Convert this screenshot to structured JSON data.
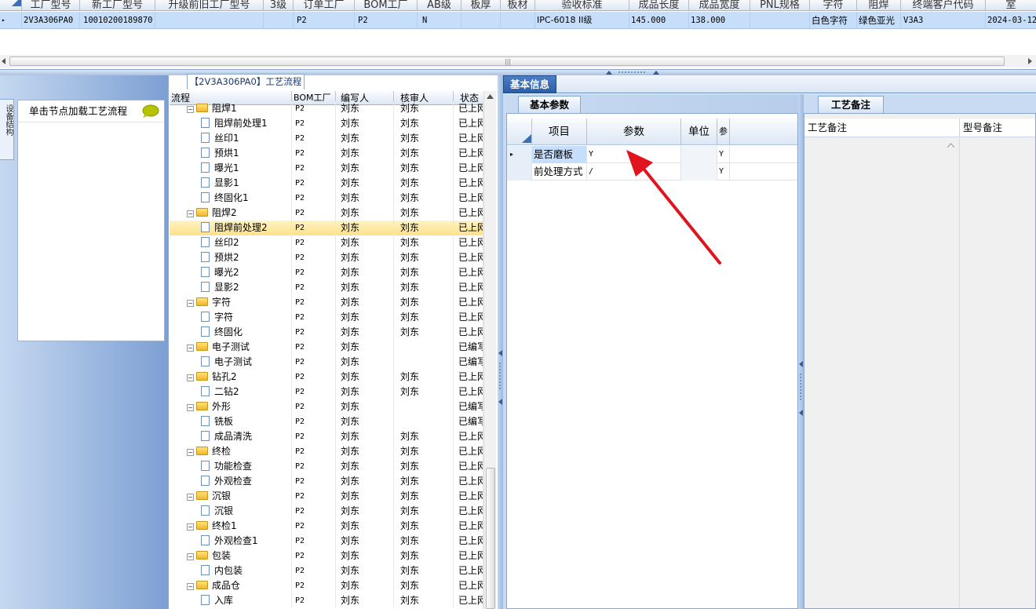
{
  "top_grid": {
    "headers": [
      "工厂型号",
      "新工厂型号",
      "升级前旧工厂型号",
      "3级",
      "订单工厂",
      "BOM工厂",
      "AB级",
      "板厚",
      "板材",
      "验收标准",
      "成品长度",
      "成品宽度",
      "PNL规格",
      "字符",
      "阻焊",
      "终端客户代码",
      "室"
    ],
    "row": {
      "marker": "▸",
      "cells": [
        "2V3A306PA0",
        "10010200189870",
        "",
        "",
        "P2",
        "P2",
        "N",
        "",
        "",
        "IPC-6018 II级",
        "145.000",
        "138.000",
        "",
        "白色字符",
        "绿色亚光",
        "V3A3",
        "2024-03-12"
      ]
    }
  },
  "left_panel": {
    "vertical_tab": "设备结构",
    "node_hint": "单击节点加载工艺流程"
  },
  "tree": {
    "title": "【2V3A306PA0】工艺流程",
    "columns": [
      "流程",
      "BOM工厂",
      "编写人",
      "核审人",
      "状态"
    ],
    "rows": [
      {
        "indent": 1,
        "type": "folder",
        "name": "阻焊1",
        "bom": "P2",
        "writer": "刘东",
        "reviewer": "刘东",
        "status": "已上网"
      },
      {
        "indent": 2,
        "type": "doc",
        "name": "阻焊前处理1",
        "bom": "P2",
        "writer": "刘东",
        "reviewer": "刘东",
        "status": "已上网"
      },
      {
        "indent": 2,
        "type": "doc",
        "name": "丝印1",
        "bom": "P2",
        "writer": "刘东",
        "reviewer": "刘东",
        "status": "已上网"
      },
      {
        "indent": 2,
        "type": "doc",
        "name": "预烘1",
        "bom": "P2",
        "writer": "刘东",
        "reviewer": "刘东",
        "status": "已上网"
      },
      {
        "indent": 2,
        "type": "doc",
        "name": "曝光1",
        "bom": "P2",
        "writer": "刘东",
        "reviewer": "刘东",
        "status": "已上网"
      },
      {
        "indent": 2,
        "type": "doc",
        "name": "显影1",
        "bom": "P2",
        "writer": "刘东",
        "reviewer": "刘东",
        "status": "已上网"
      },
      {
        "indent": 2,
        "type": "doc",
        "name": "终固化1",
        "bom": "P2",
        "writer": "刘东",
        "reviewer": "刘东",
        "status": "已上网"
      },
      {
        "indent": 1,
        "type": "folder",
        "name": "阻焊2",
        "bom": "P2",
        "writer": "刘东",
        "reviewer": "刘东",
        "status": "已上网"
      },
      {
        "indent": 2,
        "type": "doc",
        "name": "阻焊前处理2",
        "bom": "P2",
        "writer": "刘东",
        "reviewer": "刘东",
        "status": "已上网",
        "selected": true
      },
      {
        "indent": 2,
        "type": "doc",
        "name": "丝印2",
        "bom": "P2",
        "writer": "刘东",
        "reviewer": "刘东",
        "status": "已上网"
      },
      {
        "indent": 2,
        "type": "doc",
        "name": "预烘2",
        "bom": "P2",
        "writer": "刘东",
        "reviewer": "刘东",
        "status": "已上网"
      },
      {
        "indent": 2,
        "type": "doc",
        "name": "曝光2",
        "bom": "P2",
        "writer": "刘东",
        "reviewer": "刘东",
        "status": "已上网"
      },
      {
        "indent": 2,
        "type": "doc",
        "name": "显影2",
        "bom": "P2",
        "writer": "刘东",
        "reviewer": "刘东",
        "status": "已上网"
      },
      {
        "indent": 1,
        "type": "folder",
        "name": "字符",
        "bom": "P2",
        "writer": "刘东",
        "reviewer": "刘东",
        "status": "已上网"
      },
      {
        "indent": 2,
        "type": "doc",
        "name": "字符",
        "bom": "P2",
        "writer": "刘东",
        "reviewer": "刘东",
        "status": "已上网"
      },
      {
        "indent": 2,
        "type": "doc",
        "name": "终固化",
        "bom": "P2",
        "writer": "刘东",
        "reviewer": "刘东",
        "status": "已上网"
      },
      {
        "indent": 1,
        "type": "folder",
        "name": "电子测试",
        "bom": "P2",
        "writer": "刘东",
        "reviewer": "",
        "status": "已编写"
      },
      {
        "indent": 2,
        "type": "doc",
        "name": "电子测试",
        "bom": "P2",
        "writer": "刘东",
        "reviewer": "",
        "status": "已编写"
      },
      {
        "indent": 1,
        "type": "folder",
        "name": "钻孔2",
        "bom": "P2",
        "writer": "刘东",
        "reviewer": "刘东",
        "status": "已上网"
      },
      {
        "indent": 2,
        "type": "doc",
        "name": "二钻2",
        "bom": "P2",
        "writer": "刘东",
        "reviewer": "刘东",
        "status": "已上网"
      },
      {
        "indent": 1,
        "type": "folder",
        "name": "外形",
        "bom": "P2",
        "writer": "刘东",
        "reviewer": "",
        "status": "已编写"
      },
      {
        "indent": 2,
        "type": "doc",
        "name": "铣板",
        "bom": "P2",
        "writer": "刘东",
        "reviewer": "",
        "status": "已编写"
      },
      {
        "indent": 2,
        "type": "doc",
        "name": "成品清洗",
        "bom": "P2",
        "writer": "刘东",
        "reviewer": "刘东",
        "status": "已上网"
      },
      {
        "indent": 1,
        "type": "folder",
        "name": "终检",
        "bom": "P2",
        "writer": "刘东",
        "reviewer": "刘东",
        "status": "已上网"
      },
      {
        "indent": 2,
        "type": "doc",
        "name": "功能检查",
        "bom": "P2",
        "writer": "刘东",
        "reviewer": "刘东",
        "status": "已上网"
      },
      {
        "indent": 2,
        "type": "doc",
        "name": "外观检查",
        "bom": "P2",
        "writer": "刘东",
        "reviewer": "刘东",
        "status": "已上网"
      },
      {
        "indent": 1,
        "type": "folder",
        "name": "沉银",
        "bom": "P2",
        "writer": "刘东",
        "reviewer": "刘东",
        "status": "已上网"
      },
      {
        "indent": 2,
        "type": "doc",
        "name": "沉银",
        "bom": "P2",
        "writer": "刘东",
        "reviewer": "刘东",
        "status": "已上网"
      },
      {
        "indent": 1,
        "type": "folder",
        "name": "终检1",
        "bom": "P2",
        "writer": "刘东",
        "reviewer": "刘东",
        "status": "已上网"
      },
      {
        "indent": 2,
        "type": "doc",
        "name": "外观检查1",
        "bom": "P2",
        "writer": "刘东",
        "reviewer": "刘东",
        "status": "已上网"
      },
      {
        "indent": 1,
        "type": "folder",
        "name": "包装",
        "bom": "P2",
        "writer": "刘东",
        "reviewer": "刘东",
        "status": "已上网"
      },
      {
        "indent": 2,
        "type": "doc",
        "name": "内包装",
        "bom": "P2",
        "writer": "刘东",
        "reviewer": "刘东",
        "status": "已上网"
      },
      {
        "indent": 1,
        "type": "folder",
        "name": "成品仓",
        "bom": "P2",
        "writer": "刘东",
        "reviewer": "刘东",
        "status": "已上网"
      },
      {
        "indent": 2,
        "type": "doc",
        "name": "入库",
        "bom": "P2",
        "writer": "刘东",
        "reviewer": "刘东",
        "status": "已上网"
      }
    ]
  },
  "basic_info": {
    "tab_label": "基本信息",
    "params_tab": "基本参数",
    "columns": [
      "项目",
      "参数",
      "单位",
      "参"
    ],
    "rows": [
      {
        "item": "是否磨板",
        "value": "Y",
        "unit": "",
        "flag": "Y",
        "current": true
      },
      {
        "item": "前处理方式",
        "value": "/",
        "unit": "",
        "flag": "Y",
        "current": false
      }
    ]
  },
  "remarks": {
    "tab_label": "工艺备注",
    "col_process": "工艺备注",
    "col_model": "型号备注"
  },
  "colors": {
    "selected_row": "#fde28a",
    "accent_tab": "#2c5da6",
    "annotation_arrow": "#e0141e"
  }
}
